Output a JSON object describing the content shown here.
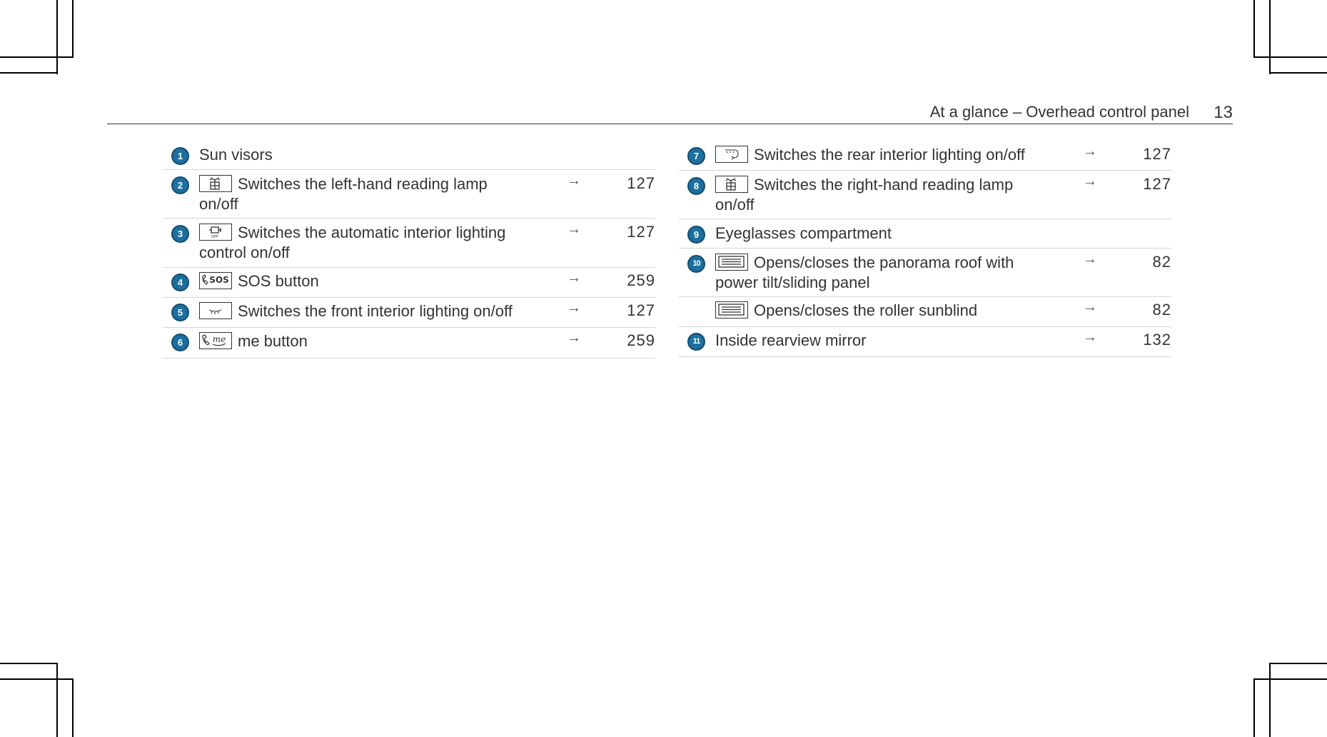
{
  "header": {
    "title": "At a glance – Overhead control panel",
    "page_number": "13"
  },
  "left_items": [
    {
      "number": "1",
      "icon": "",
      "line1": "Sun visors",
      "line2": "",
      "page": ""
    },
    {
      "number": "2",
      "icon": "reading-lamp-icon",
      "line1": "Switches the left-hand reading lamp",
      "line2": "on/off",
      "page": "127"
    },
    {
      "number": "3",
      "icon": "auto-interior-lighting-off-icon",
      "line1": "Switches the automatic interior lighting",
      "line2": "control on/off",
      "page": "127"
    },
    {
      "number": "4",
      "icon": "sos-icon",
      "line1": "SOS button",
      "line2": "",
      "page": "259"
    },
    {
      "number": "5",
      "icon": "front-interior-light-icon",
      "line1": "Switches the front interior lighting on/off",
      "line2": "",
      "page": "127"
    },
    {
      "number": "6",
      "icon": "me-phone-icon",
      "line1": "me button",
      "line2": "",
      "page": "259"
    }
  ],
  "right_items": [
    {
      "number": "7",
      "icon": "rear-interior-light-icon",
      "line1": "Switches the rear interior lighting on/off",
      "line2": "",
      "page": "127"
    },
    {
      "number": "8",
      "icon": "reading-lamp-icon",
      "line1": "Switches the right-hand reading lamp",
      "line2": "on/off",
      "page": "127"
    },
    {
      "number": "9",
      "icon": "",
      "line1": "Eyeglasses compartment",
      "line2": "",
      "page": ""
    },
    {
      "number": "10",
      "icon": "panorama-roof-icon",
      "line1": "Opens/closes the panorama roof with",
      "line2": "power tilt/sliding panel",
      "page": "82"
    },
    {
      "number": "",
      "icon": "roller-sunblind-icon",
      "line1": "Opens/closes the roller sunblind",
      "line2": "",
      "page": "82"
    },
    {
      "number": "11",
      "icon": "",
      "line1": "Inside rearview mirror",
      "line2": "",
      "page": "132"
    }
  ],
  "arrow_glyph": "→",
  "sos_label": "SOS",
  "off_label": "OFF",
  "me_label": "me",
  "colors": {
    "badge": "#1d6f9f",
    "text": "#333333",
    "rule": "#d4d4d4"
  }
}
